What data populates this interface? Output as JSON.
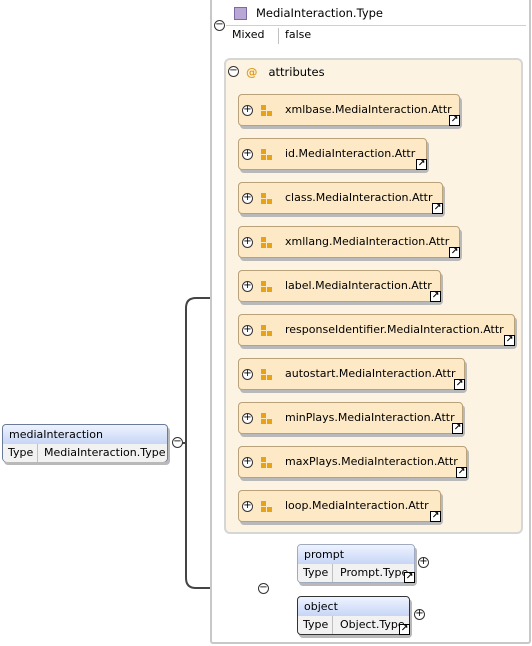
{
  "type": {
    "name": "MediaInteraction.Type",
    "mixed_key": "Mixed",
    "mixed_value": "false"
  },
  "attributes": {
    "label": "attributes",
    "items": [
      {
        "label": "xmlbase.MediaInteraction.Attr"
      },
      {
        "label": "id.MediaInteraction.Attr"
      },
      {
        "label": "class.MediaInteraction.Attr"
      },
      {
        "label": "xmllang.MediaInteraction.Attr"
      },
      {
        "label": "label.MediaInteraction.Attr"
      },
      {
        "label": "responseIdentifier.MediaInteraction.Attr"
      },
      {
        "label": "autostart.MediaInteraction.Attr"
      },
      {
        "label": "minPlays.MediaInteraction.Attr"
      },
      {
        "label": "maxPlays.MediaInteraction.Attr"
      },
      {
        "label": "loop.MediaInteraction.Attr"
      }
    ]
  },
  "root_element": {
    "name": "mediaInteraction",
    "type_key": "Type",
    "type_value": "MediaInteraction.Type"
  },
  "children": [
    {
      "name": "prompt",
      "type_key": "Type",
      "type_value": "Prompt.Type"
    },
    {
      "name": "object",
      "type_key": "Type",
      "type_value": "Object.Type"
    }
  ],
  "colors": {
    "attribute_fill": "#fde9c6",
    "attributes_panel": "#fdf3e3",
    "element_header": "#c7d6f5",
    "attribute_icon": "#e8a21a",
    "type_swatch": "#b9a7d6"
  }
}
